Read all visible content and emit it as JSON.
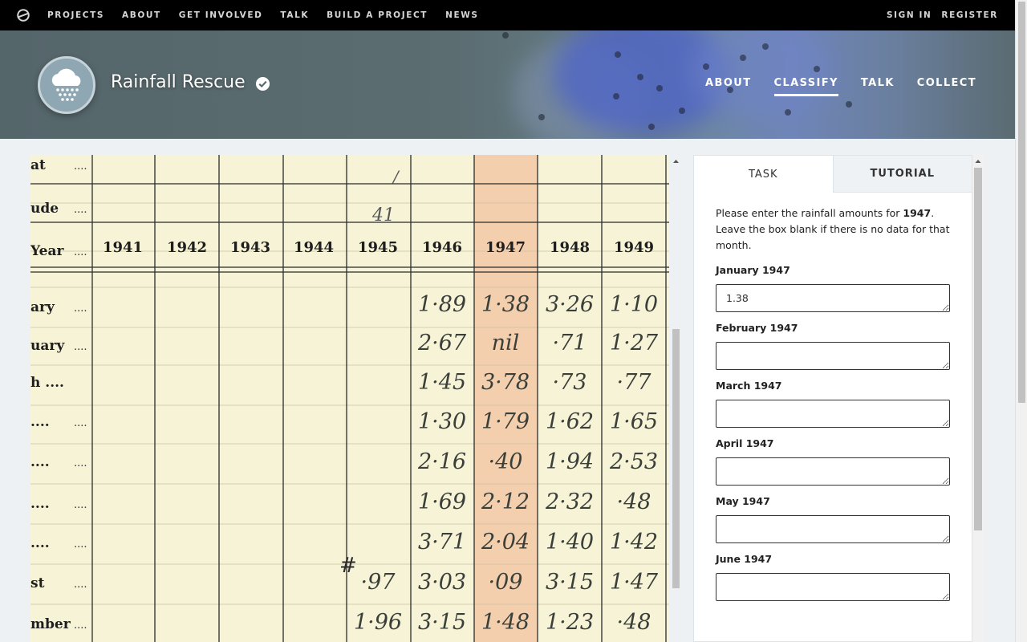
{
  "topnav": {
    "logo_icon": "zooniverse-logo-icon",
    "items": [
      "PROJECTS",
      "ABOUT",
      "GET INVOLVED",
      "TALK",
      "BUILD A PROJECT",
      "NEWS"
    ],
    "sign_in": "SIGN IN",
    "register": "REGISTER"
  },
  "project": {
    "title": "Rainfall Rescue",
    "avatar_icon": "rain-cloud-icon",
    "verified_icon": "verified-badge-icon",
    "nav": [
      "ABOUT",
      "CLASSIFY",
      "TALK",
      "COLLECT"
    ],
    "active_nav": "CLASSIFY"
  },
  "subject": {
    "row_labels": [
      "at",
      "ude",
      "Year",
      "ary",
      "uary",
      "h ....",
      "....",
      "....",
      "....",
      "....",
      "st",
      "mber"
    ],
    "leaders": "....",
    "years": [
      "1941",
      "1942",
      "1943",
      "1944",
      "1945",
      "1946",
      "1947",
      "1948",
      "1949"
    ],
    "handwritten_top": [
      "/",
      "41"
    ],
    "highlight_year": "1947",
    "rows": [
      {
        "1945": "",
        "1946": "1·89",
        "1947": "1·38",
        "1948": "3·26",
        "1949": "1·10"
      },
      {
        "1945": "",
        "1946": "2·67",
        "1947": "nil",
        "1948": "·71",
        "1949": "1·27"
      },
      {
        "1945": "",
        "1946": "1·45",
        "1947": "3·78",
        "1948": "·73",
        "1949": "·77"
      },
      {
        "1945": "",
        "1946": "1·30",
        "1947": "1·79",
        "1948": "1·62",
        "1949": "1·65"
      },
      {
        "1945": "",
        "1946": "2·16",
        "1947": "·40",
        "1948": "1·94",
        "1949": "2·53"
      },
      {
        "1945": "",
        "1946": "1·69",
        "1947": "2·12",
        "1948": "2·32",
        "1949": "·48"
      },
      {
        "1945": "",
        "1946": "3·71",
        "1947": "2·04",
        "1948": "1·40",
        "1949": "1·42"
      },
      {
        "1945": "·97",
        "1946": "3·03",
        "1947": "·09",
        "1948": "3·15",
        "1949": "1·47"
      },
      {
        "1945": "1·96",
        "1946": "3·15",
        "1947": "1·48",
        "1948": "1·23",
        "1949": "·48"
      }
    ],
    "hash_mark": "#"
  },
  "panel": {
    "tabs": [
      "TASK",
      "TUTORIAL"
    ],
    "instruction_pre": "Please enter the rainfall amounts for ",
    "instruction_year": "1947",
    "instruction_post": ". Leave the box blank if there is no data for that month.",
    "fields": [
      {
        "label": "January 1947",
        "value": "1.38"
      },
      {
        "label": "February 1947",
        "value": ""
      },
      {
        "label": "March 1947",
        "value": ""
      },
      {
        "label": "April 1947",
        "value": ""
      },
      {
        "label": "May 1947",
        "value": ""
      },
      {
        "label": "June 1947",
        "value": ""
      }
    ]
  }
}
